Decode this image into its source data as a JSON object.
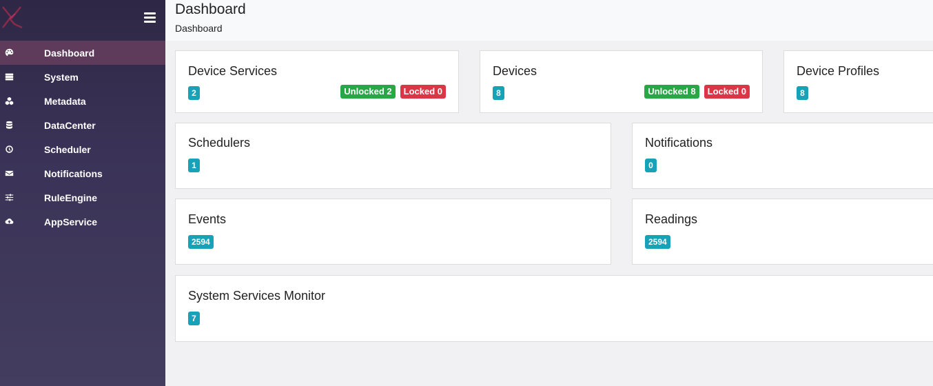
{
  "header": {
    "title": "Dashboard",
    "breadcrumb": "Dashboard"
  },
  "sidebar": {
    "items": [
      {
        "label": "Dashboard",
        "icon": "palette-icon",
        "active": true
      },
      {
        "label": "System",
        "icon": "server-icon"
      },
      {
        "label": "Metadata",
        "icon": "cubes-icon"
      },
      {
        "label": "DataCenter",
        "icon": "database-icon"
      },
      {
        "label": "Scheduler",
        "icon": "clock-icon"
      },
      {
        "label": "Notifications",
        "icon": "envelope-icon"
      },
      {
        "label": "RuleEngine",
        "icon": "sliders-icon"
      },
      {
        "label": "AppService",
        "icon": "cloud-upload-icon"
      }
    ]
  },
  "cards": {
    "device_services": {
      "title": "Device Services",
      "count": "2",
      "unlocked": "Unlocked 2",
      "locked": "Locked 0"
    },
    "devices": {
      "title": "Devices",
      "count": "8",
      "unlocked": "Unlocked 8",
      "locked": "Locked 0"
    },
    "device_profiles": {
      "title": "Device Profiles",
      "count": "8"
    },
    "schedulers": {
      "title": "Schedulers",
      "count": "1"
    },
    "notifications": {
      "title": "Notifications",
      "count": "0"
    },
    "events": {
      "title": "Events",
      "count": "2594"
    },
    "readings": {
      "title": "Readings",
      "count": "2594"
    },
    "system_services_monitor": {
      "title": "System Services Monitor",
      "count": "7"
    }
  },
  "colors": {
    "sidebar_top": "#2e2745",
    "sidebar_active": "#5e3a5b",
    "badge_info": "#17a2b8",
    "badge_success": "#28a745",
    "badge_danger": "#dc3545"
  }
}
